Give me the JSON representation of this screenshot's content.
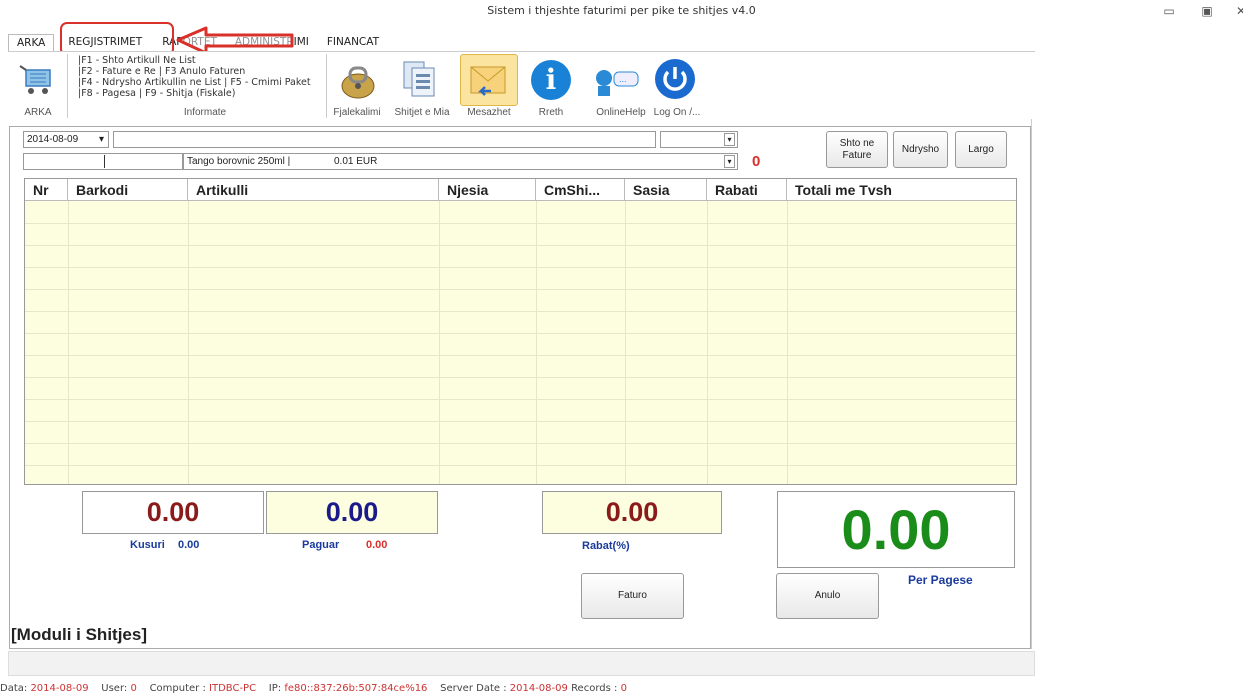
{
  "window": {
    "title": "Sistem i thjeshte faturimi per pike te shitjes v4.0"
  },
  "tabs": [
    "ARKA",
    "REGJISTRIMET",
    "RAPORTET",
    "ADMINISTRIMI",
    "FINANCAT"
  ],
  "ribbon": {
    "arka_label": "ARKA",
    "shortcuts": [
      "|F1 - Shto Artikull Ne List",
      "|F2 - Fature e Re  | F3 Anulo Faturen",
      "|F4 - Ndrysho Artikullin ne List | F5 - Cmimi Paket",
      "|F8 - Pagesa | F9 - Shitja (Fiskale)"
    ],
    "informate_label": "Informate",
    "buttons": [
      "Fjalekalimi",
      "Shitjet e Mia",
      "Mesazhet",
      "Rreth",
      "OnlineHelp",
      "Log On  /..."
    ]
  },
  "form": {
    "date": "2014-08-09",
    "barcode_value": "",
    "article_value": "Tango borovnic 250ml |",
    "price_value": "0.01 EUR",
    "count_value": "0",
    "add_button": "Shto ne\nFature",
    "edit_button": "Ndrysho",
    "remove_button": "Largo"
  },
  "table": {
    "columns": [
      "Nr",
      "Barkodi",
      "Artikulli",
      "Njesia",
      "CmShi...",
      "Sasia",
      "Rabati",
      "Totali me Tvsh"
    ],
    "rows": []
  },
  "totals": {
    "kusuri_box": "0.00",
    "paguar_box": "0.00",
    "rabat_box": "0.00",
    "per_pagese_box": "0.00",
    "kusuri_label": "Kusuri",
    "kusuri_value": "0.00",
    "paguar_label": "Paguar",
    "paguar_value": "0.00",
    "rabat_label": "Rabat(%)",
    "per_pagese_label": "Per Pagese",
    "faturo_button": "Faturo",
    "anulo_button": "Anulo"
  },
  "module_label": "[Moduli i Shitjes]",
  "statusbar": {
    "data_label": "Data:",
    "data_value": "2014-08-09",
    "user_label": "User:",
    "user_value": "0",
    "computer_label": "Computer :",
    "computer_value": "ITDBC-PC",
    "ip_label": "IP:",
    "ip_value": "fe80::837:26b:507:84ce%16",
    "server_label": "Server Date :",
    "server_value": "2014-08-09",
    "records_label": "Records :",
    "records_value": "0"
  },
  "colors": {
    "highlight_red": "#d9302a",
    "blue_value": "#1a1a8c",
    "green_value": "#1a8c1a",
    "dark_red_value": "#8b1a1a",
    "grid_bg": "#fdfde0"
  }
}
